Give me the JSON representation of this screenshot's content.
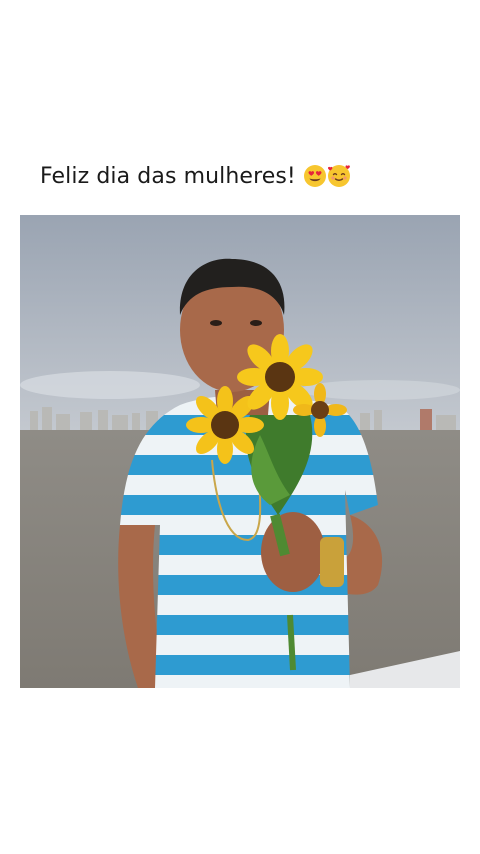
{
  "post": {
    "caption": "Feliz dia das mulheres!",
    "emojis": [
      "heart-eyes-face",
      "smiling-face-with-hearts"
    ]
  },
  "photo": {
    "description": "",
    "colors": {
      "sky": "#aab2bd",
      "sea": "#8d8a82",
      "shirt_stripe": "#2e9bd1",
      "sunflower": "#f4c21a"
    }
  }
}
